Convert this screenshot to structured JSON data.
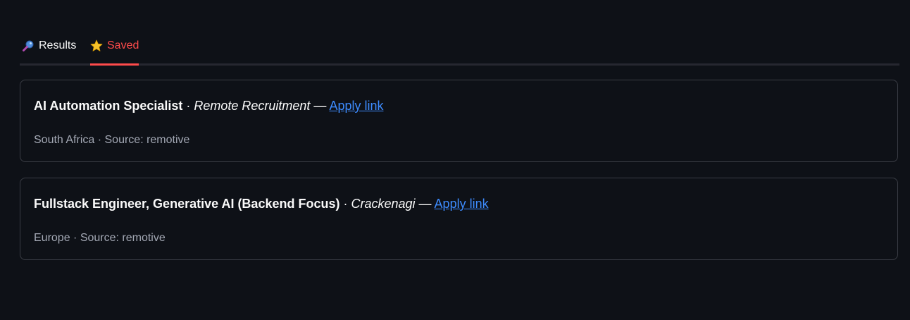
{
  "tabs": {
    "results": {
      "label": "Results",
      "icon": "magnifier-icon"
    },
    "saved": {
      "label": "Saved",
      "icon": "star-icon",
      "active": true
    }
  },
  "colors": {
    "background": "#0e1117",
    "accent": "#ff4b4b",
    "link": "#3d8bfd",
    "muted": "#a3a8b4",
    "border": "#3a3d45"
  },
  "jobs": [
    {
      "title": "AI Automation Specialist",
      "separator": " · ",
      "company": "Remote Recruitment",
      "dash": " — ",
      "link_label": "Apply link",
      "meta": "South Africa · Source: remotive"
    },
    {
      "title": "Fullstack Engineer, Generative AI (Backend Focus)",
      "separator": " · ",
      "company": "Crackenagi",
      "dash": " — ",
      "link_label": "Apply link",
      "meta": "Europe · Source: remotive"
    }
  ]
}
